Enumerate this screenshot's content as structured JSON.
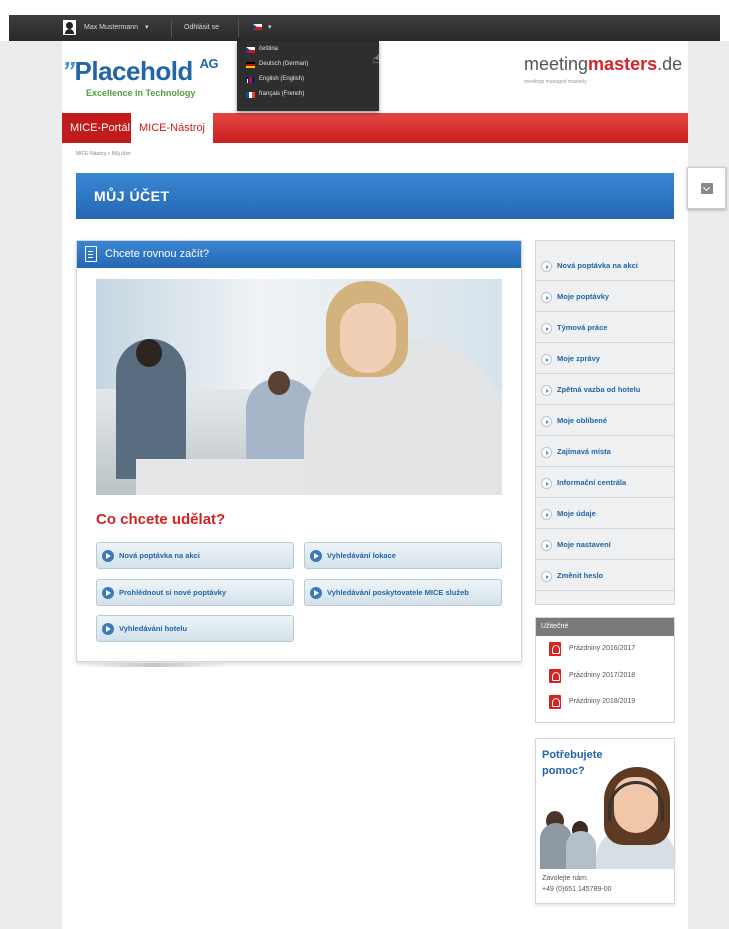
{
  "topbar": {
    "user_name": "Max Mustermann",
    "user_caret": "▾",
    "logout_label": "Odhlásit se",
    "lang_caret": "▾"
  },
  "language_menu": {
    "items": [
      {
        "label": "čeština",
        "flag": "flag-cz"
      },
      {
        "label": "Deutsch (German)",
        "flag": "flag-de"
      },
      {
        "label": "English (English)",
        "flag": "flag-gb"
      },
      {
        "label": "français (French)",
        "flag": "flag-fr"
      }
    ]
  },
  "brand": {
    "logo_mark": "”",
    "logo_name": "Placehold",
    "logo_suffix": "AG",
    "tagline": "Excellence in Technology",
    "partner_prefix": "meeting",
    "partner_bold": "masters",
    "partner_suffix": ".de",
    "partner_tagline": "meetings managed masterly"
  },
  "nav": {
    "tabs": [
      {
        "label": "MICE-Portál"
      },
      {
        "label": "MICE-Nástroj"
      }
    ]
  },
  "breadcrumb": "MICE-Nástroj  >  Můj účet",
  "page_title": "MŮJ ÚČET",
  "main": {
    "panel_title": "Chcete rovnou začít?",
    "section_title": "Co chcete udělat?",
    "actions": [
      {
        "label": "Nová poptávka na akci"
      },
      {
        "label": "Vyhledávání lokace"
      },
      {
        "label": "Prohlédnout si nové poptávky"
      },
      {
        "label": "Vyhledávání poskytovatele MICE služeb"
      },
      {
        "label": "Vyhledávání hotelu"
      }
    ]
  },
  "side_menu": {
    "items": [
      {
        "label": "Nová poptávka na akci"
      },
      {
        "label": "Moje poptávky"
      },
      {
        "label": "Týmová práce"
      },
      {
        "label": "Moje zprávy"
      },
      {
        "label": "Zpětná vazba od hotelu"
      },
      {
        "label": "Moje oblíbené"
      },
      {
        "label": "Zajímavá místa"
      },
      {
        "label": "Informační centrála"
      },
      {
        "label": "Moje údaje"
      },
      {
        "label": "Moje nastavení"
      },
      {
        "label": "Změnit heslo"
      }
    ]
  },
  "useful": {
    "header": "Užitečné",
    "files": [
      {
        "label": "Prázdniny 2016/2017"
      },
      {
        "label": "Prázdniny 2017/2018"
      },
      {
        "label": "Prázdniny 2018/2019"
      }
    ]
  },
  "help": {
    "title": "Potřebujete pomoc?",
    "contact_label": "Zavolejte nám:",
    "phone": "+49 (0)651 145789-00"
  },
  "colors": {
    "brand_red": "#d32222",
    "brand_blue": "#2568b3",
    "logo_green": "#4f9e43"
  }
}
